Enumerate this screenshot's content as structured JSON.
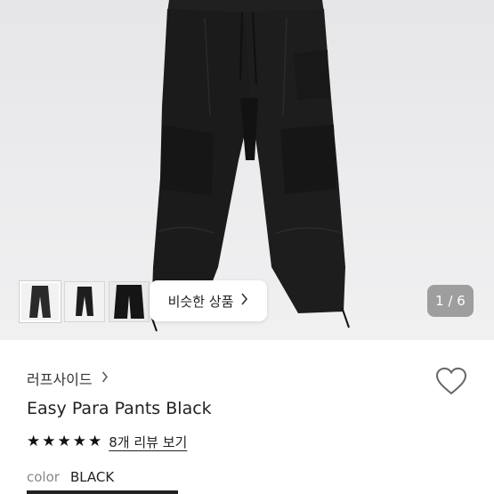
{
  "gallery": {
    "similar_button_label": "비슷한 상품",
    "page_counter": "1 / 6",
    "current_page": 1,
    "total_pages": 6,
    "thumbnails": [
      {
        "name": "thumbnail-1"
      },
      {
        "name": "thumbnail-2"
      },
      {
        "name": "thumbnail-3"
      }
    ]
  },
  "product": {
    "shop_name": "러프사이드",
    "title": "Easy Para Pants Black",
    "rating": 5,
    "review_link": "8개 리뷰 보기",
    "color_label": "color",
    "color_value": "BLACK"
  },
  "icons": {
    "shop_chevron": "chevron-right-icon",
    "similar_chevron": "chevron-right-icon",
    "wishlist": "heart-outline-icon",
    "star": "star-filled-icon"
  },
  "colors": {
    "hero_bg": "#e9e9eb",
    "garment": "#1a1a1a",
    "text": "#222222",
    "muted": "#888888"
  }
}
